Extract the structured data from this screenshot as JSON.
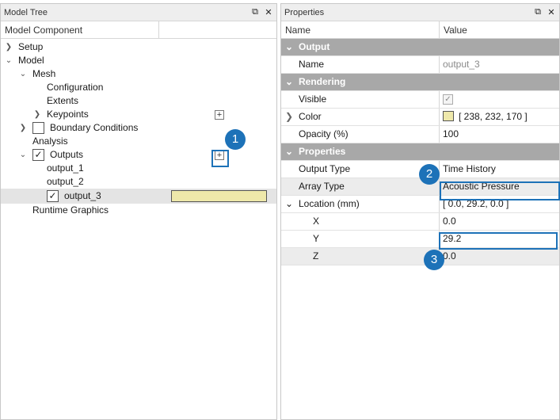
{
  "tree_panel": {
    "title": "Model Tree",
    "column": "Model Component",
    "nodes": {
      "setup": "Setup",
      "model": "Model",
      "mesh": "Mesh",
      "configuration": "Configuration",
      "extents": "Extents",
      "keypoints": "Keypoints",
      "boundary_conditions": "Boundary Conditions",
      "analysis": "Analysis",
      "outputs": "Outputs",
      "output_1": "output_1",
      "output_2": "output_2",
      "output_3": "output_3",
      "runtime_graphics": "Runtime Graphics"
    },
    "output_3_color": "#EEE8AA",
    "badge_1": "1"
  },
  "props_panel": {
    "title": "Properties",
    "col_name": "Name",
    "col_value": "Value",
    "sections": {
      "output": "Output",
      "rendering": "Rendering",
      "properties": "Properties"
    },
    "rows": {
      "name_label": "Name",
      "name_value": "output_3",
      "visible_label": "Visible",
      "color_label": "Color",
      "color_value": "[ 238, 232, 170 ]",
      "opacity_label": "Opacity (%)",
      "opacity_value": "100",
      "output_type_label": "Output Type",
      "output_type_value": "Time History",
      "array_type_label": "Array Type",
      "array_type_value": "Acoustic Pressure",
      "location_label": "Location (mm)",
      "location_value": "[ 0.0, 29.2, 0.0 ]",
      "x_label": "X",
      "x_value": "0.0",
      "y_label": "Y",
      "y_value": "29.2",
      "z_label": "Z",
      "z_value": "0.0"
    },
    "badge_2": "2",
    "badge_3": "3"
  },
  "icons": {
    "float": "window-float-icon",
    "close": "close-icon",
    "expand": "chevron-right-icon",
    "collapse": "chevron-down-icon",
    "add": "plus-icon",
    "check": "checkmark-icon"
  }
}
